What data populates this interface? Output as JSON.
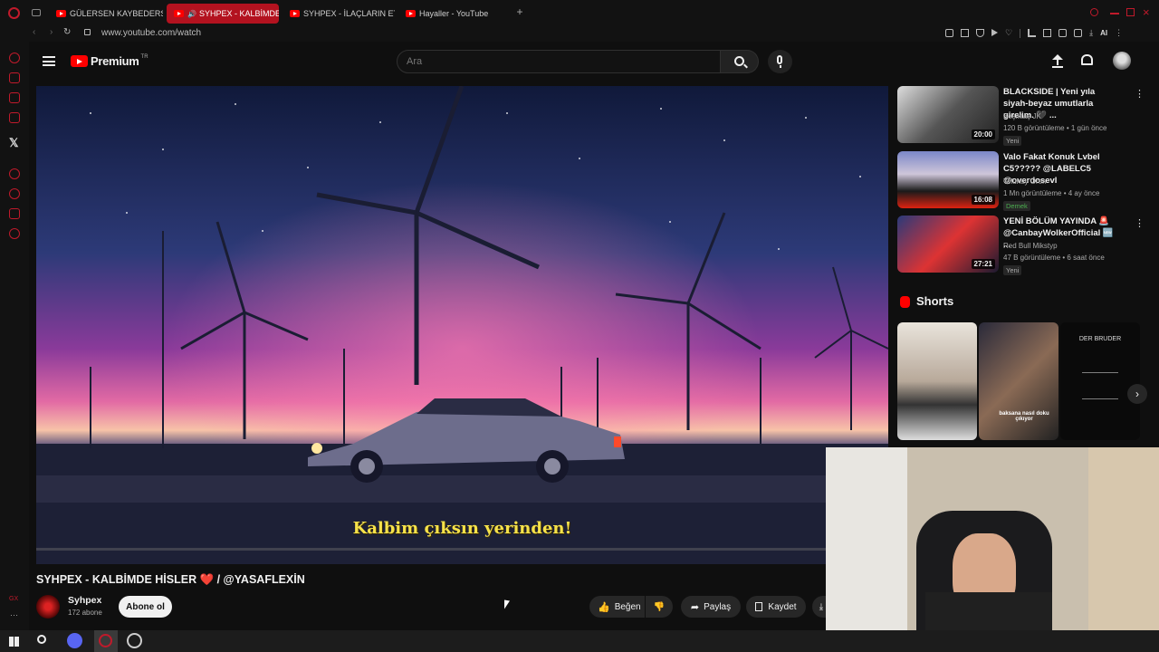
{
  "browser": {
    "tabs": [
      {
        "label": "GÜLERSEN KAYBEDERSİN"
      },
      {
        "label": "SYHPEX - KALBİMDE"
      },
      {
        "label": "SYHPEX - İLAÇLARIN ETK"
      },
      {
        "label": "Hayaller - YouTube"
      }
    ],
    "url": "www.youtube.com/watch",
    "toolbar_ai": "AI"
  },
  "youtube": {
    "logo": "Premium",
    "region": "TR",
    "search_placeholder": "Ara",
    "video": {
      "subtitle": "Kalbim çıksın yerinden!",
      "title": "SYHPEX - KALBİMDE HİSLER ❤️ / @YASAFLEXİN",
      "channel": "Syhpex",
      "subscribers": "172 abone",
      "subscribe": "Abone ol",
      "like": "Beğen",
      "share": "Paylaş",
      "save": "Kaydet"
    },
    "recommendations": [
      {
        "title": "BLACKSIDE | Yeni yıla siyah-beyaz umutlarla girelim. 🖤 ...",
        "channel": "Beşiktaş JK",
        "meta": "120 B görüntüleme • 1 gün önce",
        "badge": "Yeni",
        "duration": "20:00"
      },
      {
        "title": "Valo Fakat Konuk Lvbel C5????? @LABELC5 @overdosevl",
        "channel": "Tolunay Ören",
        "meta": "1 Mn görüntüleme • 4 ay önce",
        "badge": "Demek",
        "duration": "16:08"
      },
      {
        "title": "YENİ BÖLÜM YAYINDA 🚨 @CanbayWolkerOfficial 🆕 ...",
        "channel": "Red Bull Mikstyp",
        "meta": "47 B görüntüleme • 6 saat önce",
        "badge": "Yeni",
        "duration": "27:21"
      }
    ],
    "shorts_heading": "Shorts",
    "shorts": [
      {
        "caption": ""
      },
      {
        "caption": "baksana nasıl doku çıkıyor"
      },
      {
        "caption": "DER BRUDER"
      }
    ]
  }
}
